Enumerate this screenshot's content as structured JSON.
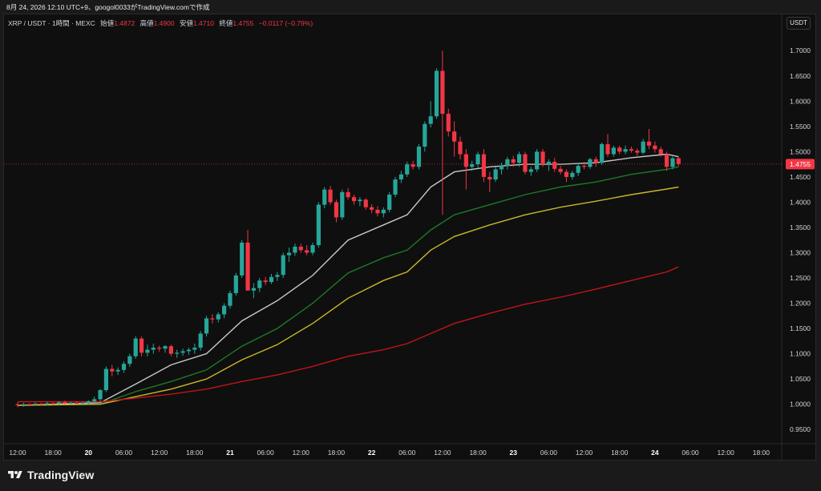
{
  "caption": "8月 24, 2026 12:10 UTC+9、googol0033がTradingView.comで作成",
  "legend": {
    "symbol": "XRP / USDT · 1時間 · MEXC",
    "open_label": "始値",
    "open": "1.4872",
    "high_label": "高値",
    "high": "1.4900",
    "low_label": "安値",
    "low": "1.4710",
    "close_label": "終値",
    "close": "1.4755",
    "change": "−0.0117 (−0.79%)"
  },
  "currency_button": "USDT",
  "footer": {
    "brand": "TradingView",
    "logo_icon": "tradingview-logo-icon"
  },
  "colors": {
    "up": "#26a69a",
    "down": "#f23645",
    "ema_fast": "#c8c8c8",
    "ema_mid": "#1b7a2a",
    "ema_slow": "#c9b62a",
    "ema_long": "#c0141c"
  },
  "chart_data": {
    "type": "candlestick",
    "symbol": "XRP / USDT",
    "interval": "1時間",
    "exchange": "MEXC",
    "ylim": [
      0.925,
      1.74
    ],
    "y_ticks": [
      "1.7000",
      "1.6500",
      "1.6000",
      "1.5500",
      "1.5000",
      "1.4500",
      "1.4000",
      "1.3500",
      "1.3000",
      "1.2500",
      "1.2000",
      "1.1500",
      "1.1000",
      "1.0500",
      "1.0000",
      "0.9500"
    ],
    "current_price": "1.4755",
    "x_ticks": [
      "12:00",
      "18:00",
      "20",
      "06:00",
      "12:00",
      "18:00",
      "21",
      "06:00",
      "12:00",
      "18:00",
      "22",
      "06:00",
      "12:00",
      "18:00",
      "23",
      "06:00",
      "12:00",
      "18:00",
      "24",
      "06:00",
      "12:00",
      "18:00"
    ],
    "x_tick_hours": [
      0,
      6,
      12,
      18,
      24,
      30,
      36,
      42,
      48,
      54,
      60,
      66,
      72,
      78,
      84,
      90,
      96,
      102,
      108,
      114,
      120,
      126
    ],
    "candles": [
      [
        0,
        1.0,
        1.004,
        0.994,
        0.998
      ],
      [
        1,
        0.998,
        1.003,
        0.995,
        1.0
      ],
      [
        2,
        1.0,
        1.002,
        0.996,
        0.999
      ],
      [
        3,
        0.999,
        1.004,
        0.997,
        1.001
      ],
      [
        4,
        1.001,
        1.003,
        0.998,
        1.0
      ],
      [
        5,
        1.0,
        1.005,
        0.998,
        1.002
      ],
      [
        6,
        1.002,
        1.004,
        0.999,
        1.001
      ],
      [
        7,
        1.001,
        1.006,
        0.999,
        1.004
      ],
      [
        8,
        1.004,
        1.007,
        1.0,
        1.002
      ],
      [
        9,
        1.002,
        1.005,
        0.999,
        1.003
      ],
      [
        10,
        1.003,
        1.006,
        1.0,
        1.001
      ],
      [
        11,
        1.001,
        1.004,
        0.998,
        1.002
      ],
      [
        12,
        1.002,
        1.008,
        0.999,
        1.006
      ],
      [
        13,
        1.006,
        1.015,
        1.003,
        1.01
      ],
      [
        14,
        1.01,
        1.03,
        1.006,
        1.028
      ],
      [
        15,
        1.028,
        1.075,
        1.024,
        1.07
      ],
      [
        16,
        1.07,
        1.078,
        1.055,
        1.065
      ],
      [
        17,
        1.065,
        1.073,
        1.058,
        1.068
      ],
      [
        18,
        1.068,
        1.085,
        1.062,
        1.08
      ],
      [
        19,
        1.08,
        1.1,
        1.074,
        1.095
      ],
      [
        20,
        1.095,
        1.135,
        1.09,
        1.13
      ],
      [
        21,
        1.13,
        1.134,
        1.095,
        1.102
      ],
      [
        22,
        1.102,
        1.118,
        1.095,
        1.108
      ],
      [
        23,
        1.108,
        1.12,
        1.1,
        1.112
      ],
      [
        24,
        1.112,
        1.116,
        1.104,
        1.11
      ],
      [
        25,
        1.11,
        1.117,
        1.102,
        1.115
      ],
      [
        26,
        1.115,
        1.118,
        1.095,
        1.1
      ],
      [
        27,
        1.1,
        1.108,
        1.092,
        1.102
      ],
      [
        28,
        1.102,
        1.11,
        1.096,
        1.105
      ],
      [
        29,
        1.105,
        1.112,
        1.098,
        1.108
      ],
      [
        30,
        1.108,
        1.12,
        1.1,
        1.112
      ],
      [
        31,
        1.112,
        1.145,
        1.106,
        1.14
      ],
      [
        32,
        1.14,
        1.175,
        1.134,
        1.17
      ],
      [
        33,
        1.17,
        1.178,
        1.16,
        1.168
      ],
      [
        34,
        1.168,
        1.182,
        1.162,
        1.178
      ],
      [
        35,
        1.178,
        1.2,
        1.17,
        1.195
      ],
      [
        36,
        1.195,
        1.225,
        1.19,
        1.22
      ],
      [
        37,
        1.22,
        1.26,
        1.215,
        1.255
      ],
      [
        38,
        1.255,
        1.325,
        1.25,
        1.32
      ],
      [
        39,
        1.32,
        1.345,
        1.26,
        1.225
      ],
      [
        40,
        1.225,
        1.24,
        1.21,
        1.23
      ],
      [
        41,
        1.23,
        1.25,
        1.222,
        1.245
      ],
      [
        42,
        1.245,
        1.252,
        1.236,
        1.242
      ],
      [
        43,
        1.242,
        1.258,
        1.238,
        1.252
      ],
      [
        44,
        1.252,
        1.262,
        1.244,
        1.256
      ],
      [
        45,
        1.256,
        1.3,
        1.25,
        1.295
      ],
      [
        46,
        1.295,
        1.31,
        1.282,
        1.3
      ],
      [
        47,
        1.3,
        1.318,
        1.294,
        1.312
      ],
      [
        48,
        1.312,
        1.318,
        1.3,
        1.305
      ],
      [
        49,
        1.305,
        1.315,
        1.295,
        1.3
      ],
      [
        50,
        1.3,
        1.32,
        1.295,
        1.315
      ],
      [
        51,
        1.315,
        1.4,
        1.31,
        1.395
      ],
      [
        52,
        1.395,
        1.43,
        1.388,
        1.425
      ],
      [
        53,
        1.425,
        1.432,
        1.395,
        1.4
      ],
      [
        54,
        1.4,
        1.405,
        1.36,
        1.37
      ],
      [
        55,
        1.37,
        1.425,
        1.365,
        1.42
      ],
      [
        56,
        1.42,
        1.428,
        1.405,
        1.41
      ],
      [
        57,
        1.41,
        1.415,
        1.395,
        1.402
      ],
      [
        58,
        1.402,
        1.41,
        1.392,
        1.405
      ],
      [
        59,
        1.405,
        1.408,
        1.385,
        1.39
      ],
      [
        60,
        1.39,
        1.396,
        1.378,
        1.385
      ],
      [
        61,
        1.385,
        1.392,
        1.372,
        1.378
      ],
      [
        62,
        1.378,
        1.39,
        1.37,
        1.385
      ],
      [
        63,
        1.385,
        1.42,
        1.38,
        1.415
      ],
      [
        64,
        1.415,
        1.45,
        1.41,
        1.445
      ],
      [
        65,
        1.445,
        1.462,
        1.438,
        1.455
      ],
      [
        66,
        1.455,
        1.48,
        1.45,
        1.475
      ],
      [
        67,
        1.475,
        1.482,
        1.465,
        1.47
      ],
      [
        68,
        1.47,
        1.515,
        1.465,
        1.51
      ],
      [
        69,
        1.51,
        1.56,
        1.5,
        1.555
      ],
      [
        70,
        1.555,
        1.6,
        1.548,
        1.57
      ],
      [
        71,
        1.57,
        1.665,
        1.565,
        1.66
      ],
      [
        72,
        1.66,
        1.7,
        1.375,
        1.575
      ],
      [
        73,
        1.575,
        1.585,
        1.53,
        1.54
      ],
      [
        74,
        1.54,
        1.56,
        1.49,
        1.52
      ],
      [
        75,
        1.52,
        1.53,
        1.485,
        1.495
      ],
      [
        76,
        1.495,
        1.505,
        1.425,
        1.47
      ],
      [
        77,
        1.47,
        1.482,
        1.462,
        1.475
      ],
      [
        78,
        1.475,
        1.5,
        1.468,
        1.495
      ],
      [
        79,
        1.495,
        1.505,
        1.44,
        1.45
      ],
      [
        80,
        1.45,
        1.46,
        1.42,
        1.445
      ],
      [
        81,
        1.445,
        1.47,
        1.44,
        1.465
      ],
      [
        82,
        1.465,
        1.478,
        1.455,
        1.472
      ],
      [
        83,
        1.472,
        1.49,
        1.465,
        1.485
      ],
      [
        84,
        1.485,
        1.492,
        1.47,
        1.478
      ],
      [
        85,
        1.478,
        1.5,
        1.47,
        1.495
      ],
      [
        86,
        1.495,
        1.5,
        1.455,
        1.46
      ],
      [
        87,
        1.46,
        1.47,
        1.452,
        1.465
      ],
      [
        88,
        1.465,
        1.505,
        1.46,
        1.5
      ],
      [
        89,
        1.5,
        1.505,
        1.47,
        1.475
      ],
      [
        90,
        1.475,
        1.485,
        1.462,
        1.48
      ],
      [
        91,
        1.48,
        1.488,
        1.46,
        1.466
      ],
      [
        92,
        1.466,
        1.472,
        1.455,
        1.46
      ],
      [
        93,
        1.46,
        1.465,
        1.44,
        1.45
      ],
      [
        94,
        1.45,
        1.462,
        1.445,
        1.458
      ],
      [
        95,
        1.458,
        1.478,
        1.452,
        1.472
      ],
      [
        96,
        1.472,
        1.48,
        1.465,
        1.47
      ],
      [
        97,
        1.47,
        1.488,
        1.466,
        1.485
      ],
      [
        98,
        1.485,
        1.49,
        1.47,
        1.478
      ],
      [
        99,
        1.478,
        1.518,
        1.474,
        1.515
      ],
      [
        100,
        1.515,
        1.535,
        1.49,
        1.495
      ],
      [
        101,
        1.495,
        1.512,
        1.49,
        1.508
      ],
      [
        102,
        1.508,
        1.512,
        1.495,
        1.5
      ],
      [
        103,
        1.5,
        1.512,
        1.495,
        1.505
      ],
      [
        104,
        1.505,
        1.51,
        1.498,
        1.502
      ],
      [
        105,
        1.502,
        1.506,
        1.492,
        1.498
      ],
      [
        106,
        1.498,
        1.525,
        1.495,
        1.52
      ],
      [
        107,
        1.52,
        1.545,
        1.505,
        1.512
      ],
      [
        108,
        1.512,
        1.52,
        1.498,
        1.505
      ],
      [
        109,
        1.505,
        1.51,
        1.49,
        1.495
      ],
      [
        110,
        1.495,
        1.5,
        1.462,
        1.47
      ],
      [
        111,
        1.47,
        1.49,
        1.465,
        1.487
      ],
      [
        112,
        1.487,
        1.49,
        1.471,
        1.4755
      ]
    ],
    "ema_lines": [
      {
        "color": "#c8c8c8",
        "points": [
          [
            0,
            0.998
          ],
          [
            14,
            1.003
          ],
          [
            20,
            1.04
          ],
          [
            26,
            1.078
          ],
          [
            32,
            1.1
          ],
          [
            38,
            1.165
          ],
          [
            44,
            1.205
          ],
          [
            50,
            1.255
          ],
          [
            56,
            1.325
          ],
          [
            62,
            1.355
          ],
          [
            66,
            1.375
          ],
          [
            70,
            1.43
          ],
          [
            74,
            1.46
          ],
          [
            80,
            1.47
          ],
          [
            86,
            1.475
          ],
          [
            92,
            1.475
          ],
          [
            98,
            1.478
          ],
          [
            104,
            1.488
          ],
          [
            110,
            1.495
          ],
          [
            112,
            1.49
          ]
        ]
      },
      {
        "color": "#1b7a2a",
        "points": [
          [
            0,
            0.998
          ],
          [
            14,
            1.0
          ],
          [
            20,
            1.025
          ],
          [
            26,
            1.045
          ],
          [
            32,
            1.068
          ],
          [
            38,
            1.115
          ],
          [
            44,
            1.15
          ],
          [
            50,
            1.2
          ],
          [
            56,
            1.26
          ],
          [
            62,
            1.29
          ],
          [
            66,
            1.305
          ],
          [
            70,
            1.345
          ],
          [
            74,
            1.375
          ],
          [
            80,
            1.395
          ],
          [
            86,
            1.415
          ],
          [
            92,
            1.43
          ],
          [
            98,
            1.44
          ],
          [
            104,
            1.455
          ],
          [
            110,
            1.465
          ],
          [
            112,
            1.47
          ]
        ]
      },
      {
        "color": "#c9b62a",
        "points": [
          [
            0,
            0.998
          ],
          [
            14,
            1.0
          ],
          [
            20,
            1.015
          ],
          [
            26,
            1.03
          ],
          [
            32,
            1.05
          ],
          [
            38,
            1.088
          ],
          [
            44,
            1.118
          ],
          [
            50,
            1.16
          ],
          [
            56,
            1.21
          ],
          [
            62,
            1.245
          ],
          [
            66,
            1.262
          ],
          [
            70,
            1.305
          ],
          [
            74,
            1.332
          ],
          [
            80,
            1.355
          ],
          [
            86,
            1.375
          ],
          [
            92,
            1.39
          ],
          [
            98,
            1.402
          ],
          [
            104,
            1.415
          ],
          [
            110,
            1.426
          ],
          [
            112,
            1.43
          ]
        ]
      },
      {
        "color": "#c0141c",
        "points": [
          [
            0,
            1.005
          ],
          [
            14,
            1.005
          ],
          [
            20,
            1.012
          ],
          [
            26,
            1.02
          ],
          [
            32,
            1.03
          ],
          [
            38,
            1.045
          ],
          [
            44,
            1.058
          ],
          [
            50,
            1.075
          ],
          [
            56,
            1.095
          ],
          [
            62,
            1.108
          ],
          [
            66,
            1.12
          ],
          [
            70,
            1.14
          ],
          [
            74,
            1.16
          ],
          [
            80,
            1.18
          ],
          [
            86,
            1.198
          ],
          [
            92,
            1.212
          ],
          [
            98,
            1.228
          ],
          [
            104,
            1.245
          ],
          [
            110,
            1.262
          ],
          [
            112,
            1.272
          ]
        ]
      }
    ]
  }
}
